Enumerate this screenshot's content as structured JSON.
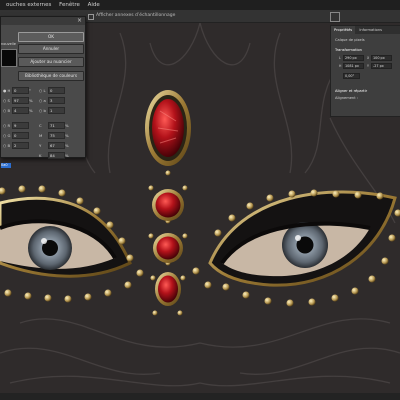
{
  "menubar": {
    "items": [
      "ouches externes",
      "Fenêtre",
      "Aide"
    ]
  },
  "optionsbar": {
    "auto_select_text": "Afficher annexes d’échantillonnage"
  },
  "color_picker": {
    "new_label": "nouvelle",
    "buttons": {
      "ok": "OK",
      "cancel": "Annuler",
      "add_swatch": "Ajouter au nuancier",
      "libraries": "Bibliothèque de couleurs"
    },
    "fields": {
      "H": "0",
      "S": "97",
      "B": "4",
      "R": "9",
      "G": "0",
      "Bl": "2",
      "L": "0",
      "a": "3",
      "b": "1",
      "C": "71",
      "M": "75",
      "Y": "67",
      "K": "84",
      "hex": "0a0"
    },
    "units": {
      "deg": "°",
      "pct": "%"
    }
  },
  "properties": {
    "tabs": [
      "Propriétés",
      "Informations"
    ],
    "layer_type": "Calque de pixels",
    "transform_title": "Transformation",
    "w": "290 px",
    "h": "1081 px",
    "x_label": "X",
    "y_label": "Y",
    "w_label": "L",
    "h_label": "H",
    "x": "100 px",
    "y": "-27 px",
    "angle": "0,00°",
    "align_title": "Aligner et répartir",
    "align_sub": "Alignement :"
  },
  "colors": {
    "canvas": "#2f2b2b",
    "gem_red": "#b3121a",
    "gold": "#b89a55",
    "ui_dark": "#1f1f1f",
    "hex_highlight": "#2d6fd0"
  }
}
